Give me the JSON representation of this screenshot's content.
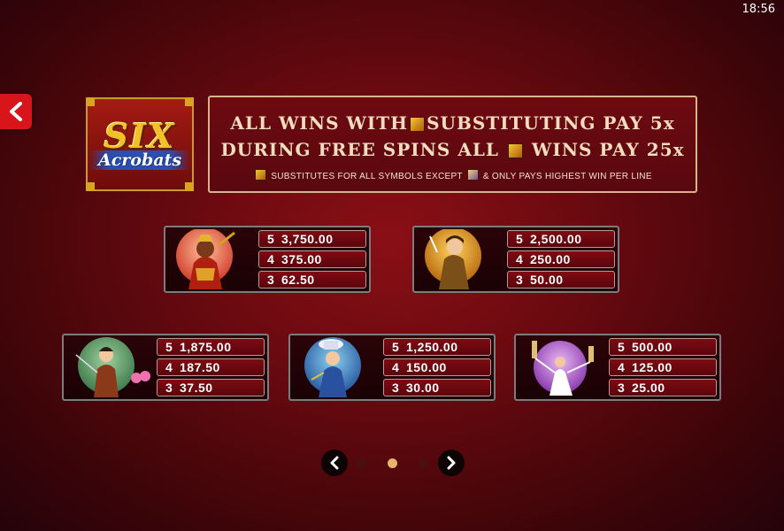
{
  "status_bar": {
    "time": "18:56"
  },
  "logo": {
    "line1": "SIX",
    "line2": "Acrobats"
  },
  "banner": {
    "line1_a": "ALL WINS WITH",
    "line1_b": "SUBSTITUTING PAY 5x",
    "line2_a": "DURING FREE SPINS ALL",
    "line2_b": "WINS PAY 25x",
    "line3_a": "SUBSTITUTES FOR ALL SYMBOLS EXCEPT",
    "line3_b": "& ONLY PAYS HIGHEST WIN PER LINE"
  },
  "paytable": [
    {
      "symbol": "monkey-king-icon",
      "rows": [
        {
          "count": "5",
          "value": "3,750.00"
        },
        {
          "count": "4",
          "value": "375.00"
        },
        {
          "count": "3",
          "value": "62.50"
        }
      ]
    },
    {
      "symbol": "dart-thrower-icon",
      "rows": [
        {
          "count": "5",
          "value": "2,500.00"
        },
        {
          "count": "4",
          "value": "250.00"
        },
        {
          "count": "3",
          "value": "50.00"
        }
      ]
    },
    {
      "symbol": "yoyo-acrobat-icon",
      "rows": [
        {
          "count": "5",
          "value": "1,875.00"
        },
        {
          "count": "4",
          "value": "187.50"
        },
        {
          "count": "3",
          "value": "37.50"
        }
      ]
    },
    {
      "symbol": "hat-juggler-icon",
      "rows": [
        {
          "count": "5",
          "value": "1,250.00"
        },
        {
          "count": "4",
          "value": "150.00"
        },
        {
          "count": "3",
          "value": "30.00"
        }
      ]
    },
    {
      "symbol": "plate-spinner-icon",
      "rows": [
        {
          "count": "5",
          "value": "500.00"
        },
        {
          "count": "4",
          "value": "125.00"
        },
        {
          "count": "3",
          "value": "25.00"
        }
      ]
    }
  ],
  "pagination": {
    "pages": 3,
    "active_page": 2
  },
  "colors": {
    "accent_red": "#d8151b",
    "gold": "#e7b56a",
    "row_red": "#7e0b12"
  }
}
